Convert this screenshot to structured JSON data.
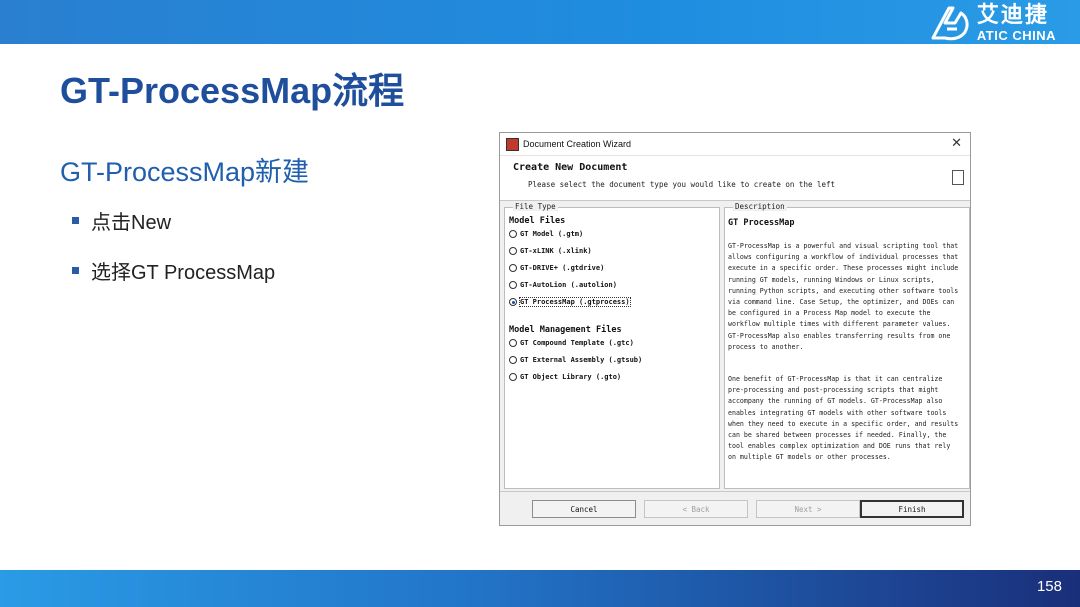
{
  "brand": {
    "logo_cn": "艾迪捷",
    "logo_en": "ATIC CHINA",
    "colors": {
      "header_blue": "#2a7fd0",
      "title_blue": "#1f4e9c",
      "footer_dark": "#1a2f7a"
    }
  },
  "slide": {
    "title": "GT-ProcessMap流程",
    "subtitle": "GT-ProcessMap新建",
    "bullets": [
      "点击New",
      "选择GT ProcessMap"
    ],
    "page_number": "158"
  },
  "dialog": {
    "title": "Document Creation Wizard",
    "close_icon": "close-icon",
    "header_title": "Create New Document",
    "header_subtitle": "Please select the document type you would like to create on the left",
    "file_type_legend": "File Type",
    "model_files_heading": "Model Files",
    "model_files": [
      {
        "label": "GT Model (.gtm)",
        "selected": false
      },
      {
        "label": "GT-xLINK (.xlink)",
        "selected": false
      },
      {
        "label": "GT-DRIVE+ (.gtdrive)",
        "selected": false
      },
      {
        "label": "GT-AutoLion (.autolion)",
        "selected": false
      },
      {
        "label": "GT ProcessMap (.gtprocess)",
        "selected": true
      }
    ],
    "management_heading": "Model Management Files",
    "management_files": [
      {
        "label": "GT Compound Template (.gtc)",
        "selected": false
      },
      {
        "label": "GT External Assembly (.gtsub)",
        "selected": false
      },
      {
        "label": "GT Object Library (.gto)",
        "selected": false
      }
    ],
    "description_legend": "Description",
    "description_title": "GT ProcessMap",
    "description_p1": "GT-ProcessMap is a powerful and visual scripting tool that allows configuring a workflow of individual processes that execute in a specific order. These processes might include running GT models, running Windows or Linux scripts, running Python scripts, and executing other software tools via command line. Case Setup, the optimizer, and DOEs can be configured in a Process Map model to execute the workflow multiple times with different parameter values. GT-ProcessMap also enables transferring results from one process to another.",
    "description_p2": "One benefit of GT-ProcessMap is that it can centralize pre-processing and post-processing scripts that might accompany the running of GT models. GT-ProcessMap also enables integrating GT models with other software tools when they need to execute in a specific order, and results can be shared between processes if needed. Finally, the tool enables complex optimization and DOE runs that rely on multiple GT models or other processes.",
    "buttons": {
      "cancel": "Cancel",
      "back": "< Back",
      "next": "Next >",
      "finish": "Finish"
    }
  }
}
